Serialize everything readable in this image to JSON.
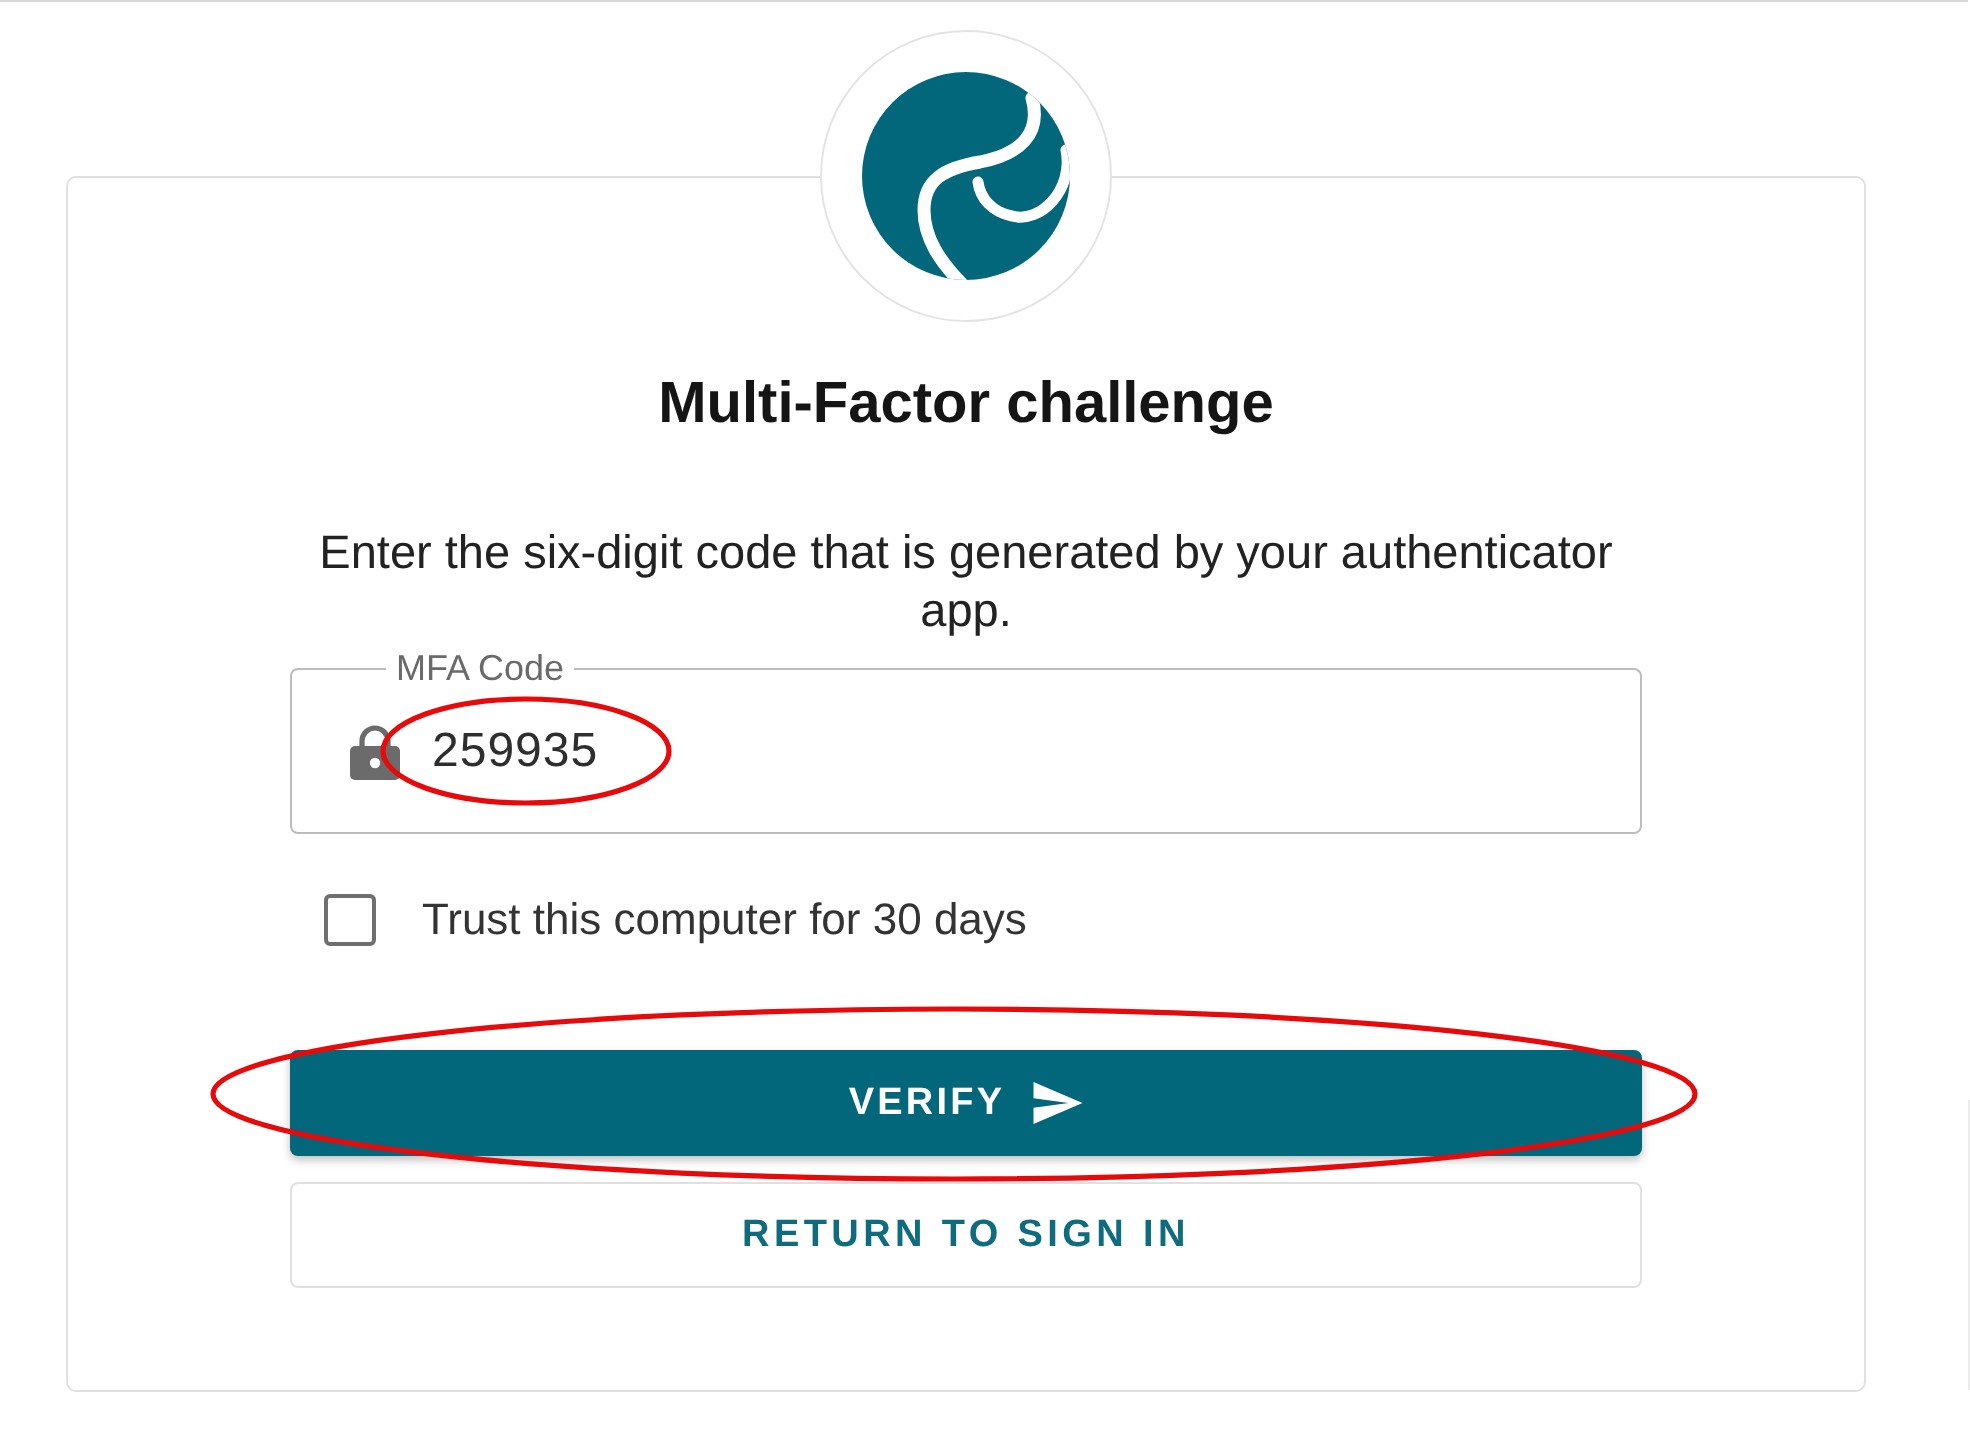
{
  "title": "Multi-Factor challenge",
  "description": "Enter the six-digit code that is generated by your authenticator app.",
  "mfa_field": {
    "label": "MFA Code",
    "value": "259935",
    "highlighted": true
  },
  "trust_computer": {
    "label": "Trust this computer for 30 days",
    "checked": false
  },
  "buttons": [
    {
      "label": "VERIFY",
      "kind": "primary",
      "highlighted": true
    },
    {
      "label": "RETURN TO SIGN IN",
      "kind": "secondary",
      "highlighted": false
    }
  ]
}
